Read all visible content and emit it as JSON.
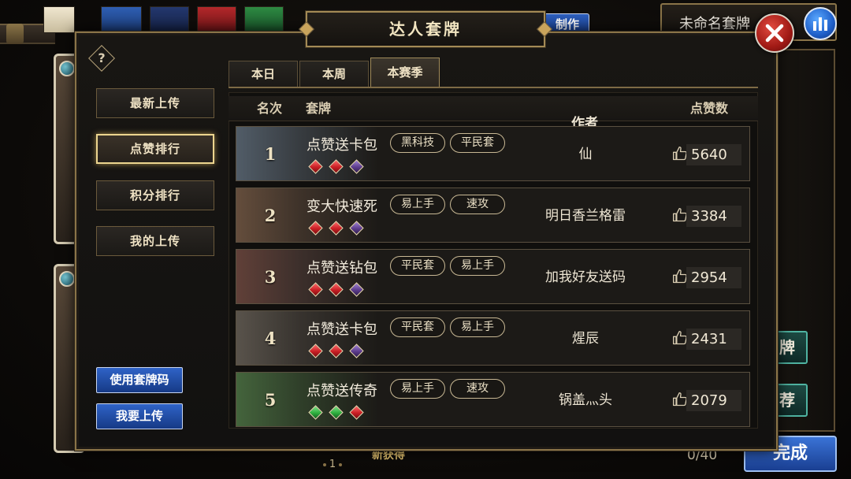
{
  "window": {
    "title": "达人套牌",
    "help_label": "?"
  },
  "background": {
    "deck_name": "未命名套牌",
    "make_label": "制作",
    "card_count": "0/40",
    "done_label": "完成",
    "side_labels": [
      "牌",
      "荐"
    ],
    "page_indicator": "1",
    "bottom_label": "新获得"
  },
  "sidebar": {
    "items": [
      {
        "label": "最新上传",
        "selected": false
      },
      {
        "label": "点赞排行",
        "selected": true
      },
      {
        "label": "积分排行",
        "selected": false
      },
      {
        "label": "我的上传",
        "selected": false
      }
    ]
  },
  "tabs": [
    {
      "label": "本日",
      "selected": false
    },
    {
      "label": "本周",
      "selected": false
    },
    {
      "label": "本赛季",
      "selected": true
    }
  ],
  "table": {
    "headers": {
      "rank": "名次",
      "deck": "套牌",
      "author": "作者",
      "likes": "点赞数"
    },
    "rows": [
      {
        "rank": "1",
        "name": "点赞送卡包",
        "tags": [
          "黑科技",
          "平民套"
        ],
        "gems": [
          "red",
          "red",
          "purple"
        ],
        "author": "仙",
        "likes": "5640"
      },
      {
        "rank": "2",
        "name": "变大快速死",
        "tags": [
          "易上手",
          "速攻"
        ],
        "gems": [
          "red",
          "red",
          "purple"
        ],
        "author": "明日香兰格雷",
        "likes": "3384"
      },
      {
        "rank": "3",
        "name": "点赞送钻包",
        "tags": [
          "平民套",
          "易上手"
        ],
        "gems": [
          "red",
          "red",
          "purple"
        ],
        "author": "加我好友送码",
        "likes": "2954"
      },
      {
        "rank": "4",
        "name": "点赞送卡包",
        "tags": [
          "平民套",
          "易上手"
        ],
        "gems": [
          "red",
          "red",
          "purple"
        ],
        "author": "煋辰",
        "likes": "2431"
      },
      {
        "rank": "5",
        "name": "点赞送传奇",
        "tags": [
          "易上手",
          "速攻"
        ],
        "gems": [
          "green",
          "green",
          "red"
        ],
        "author": "锅盖灬头",
        "likes": "2079"
      }
    ]
  },
  "actions": {
    "use_code": "使用套牌码",
    "upload": "我要上传"
  },
  "colors": {
    "accent_gold": "#c9a45c",
    "selected_gold": "#ecd58f",
    "button_blue": "#2f63c7",
    "close_red": "#c0231e"
  }
}
